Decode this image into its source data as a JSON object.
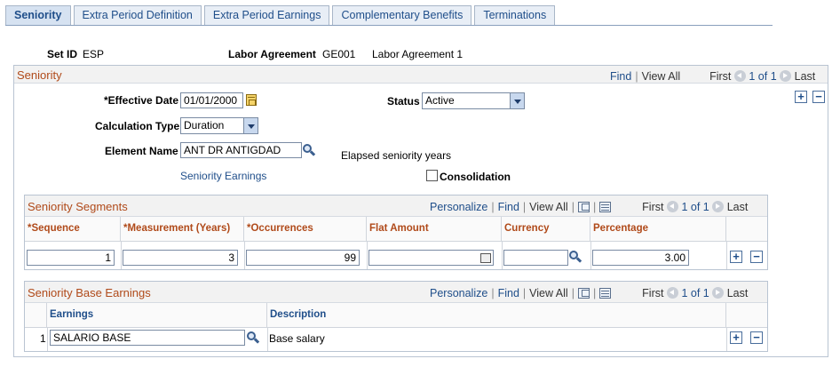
{
  "tabs": [
    {
      "label": "Seniority",
      "active": true
    },
    {
      "label": "Extra Period Definition",
      "active": false
    },
    {
      "label": "Extra Period Earnings",
      "active": false
    },
    {
      "label": "Complementary Benefits",
      "active": false
    },
    {
      "label": "Terminations",
      "active": false
    }
  ],
  "header": {
    "setid_label": "Set ID",
    "setid_value": "ESP",
    "labor_label": "Labor Agreement",
    "labor_value": "GE001",
    "labor_desc": "Labor Agreement 1"
  },
  "seniority": {
    "title": "Seniority",
    "nav": {
      "find": "Find",
      "view_all": "View All",
      "first": "First",
      "count": "1 of 1",
      "last": "Last"
    },
    "effective_date_label": "*Effective Date",
    "effective_date_value": "01/01/2000",
    "status_label": "Status",
    "status_value": "Active",
    "calc_type_label": "Calculation Type",
    "calc_type_value": "Duration",
    "element_name_label": "Element Name",
    "element_name_value": "ANT DR ANTIGDAD",
    "element_desc": "Elapsed seniority years",
    "seniority_earnings_link": "Seniority Earnings",
    "consolidation_label": "Consolidation",
    "consolidation_checked": false
  },
  "segments": {
    "title": "Seniority Segments",
    "nav": {
      "personalize": "Personalize",
      "find": "Find",
      "view_all": "View All",
      "first": "First",
      "count": "1 of 1",
      "last": "Last"
    },
    "columns": [
      "*Sequence",
      "*Measurement (Years)",
      "*Occurrences",
      "Flat Amount",
      "Currency",
      "Percentage"
    ],
    "row": {
      "sequence": "1",
      "measurement": "3",
      "occurrences": "99",
      "flat_amount": "",
      "currency": "",
      "percentage": "3.00"
    }
  },
  "base_earnings": {
    "title": "Seniority Base Earnings",
    "nav": {
      "personalize": "Personalize",
      "find": "Find",
      "view_all": "View All",
      "first": "First",
      "count": "1 of 1",
      "last": "Last"
    },
    "columns": [
      "Earnings",
      "Description"
    ],
    "row": {
      "num": "1",
      "earnings": "SALARIO BASE",
      "description": "Base salary"
    }
  },
  "icons": {
    "plus": "+",
    "minus": "−"
  }
}
